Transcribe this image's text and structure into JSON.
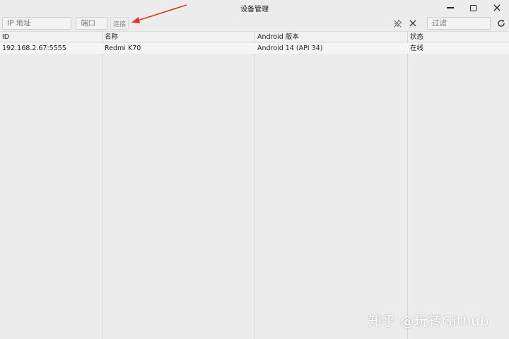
{
  "window": {
    "title": "设备管理",
    "minimize_icon": "minimize-icon",
    "maximize_icon": "maximize-icon",
    "close_icon": "close-icon"
  },
  "toolbar": {
    "ip_placeholder": "IP 地址",
    "port_placeholder": "端口",
    "connect_label": "连接",
    "pin_icon": "pin-off-icon",
    "clear_icon": "clear-icon",
    "filter_placeholder": "过滤",
    "refresh_icon": "refresh-icon"
  },
  "table": {
    "columns": [
      "ID",
      "名称",
      "Android 版本",
      "状态"
    ],
    "rows": [
      {
        "id": "192.168.2.67:5555",
        "name": "Redmi K70",
        "android": "Android 14 (API 34)",
        "status": "在线"
      }
    ]
  },
  "annotation": {
    "arrow_color": "#e0322a"
  },
  "watermark": "知乎 @玩转Github"
}
